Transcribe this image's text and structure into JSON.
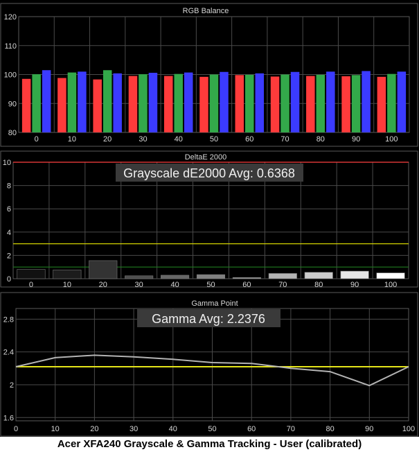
{
  "caption": "Acer XFA240 Grayscale & Gamma Tracking - User (calibrated)",
  "colors": {
    "panel_bg": "#000000",
    "frame": "#5a5a5a",
    "grid": "#4a4a4a",
    "text": "#d8d8d8",
    "red": "#ff3b3b",
    "green": "#33a94a",
    "blue": "#3b3bff",
    "gamma_line": "#b4b4b4",
    "target_line": "#e6e619",
    "threshold_yellow": "#d4d400",
    "threshold_green": "#1f7a1f",
    "threshold_red": "#ff4040",
    "overlay_bg": "#3a3a3a"
  },
  "chart_data": [
    {
      "type": "bar",
      "title": "RGB Balance",
      "categories": [
        "0",
        "10",
        "20",
        "30",
        "40",
        "50",
        "60",
        "70",
        "80",
        "90",
        "100"
      ],
      "yticks": [
        "80",
        "90",
        "100",
        "110",
        "120"
      ],
      "ylim": [
        80,
        120
      ],
      "series": [
        {
          "color_key": "red",
          "values": [
            98.5,
            98.8,
            98.3,
            99.5,
            99.5,
            99.2,
            99.8,
            99.3,
            99.5,
            99.4,
            99.2
          ]
        },
        {
          "color_key": "green",
          "values": [
            100.1,
            100.7,
            101.5,
            100.1,
            100.2,
            100.0,
            99.9,
            100.0,
            99.9,
            99.8,
            100.2
          ]
        },
        {
          "color_key": "blue",
          "values": [
            101.5,
            101.0,
            100.4,
            100.6,
            100.7,
            100.9,
            100.4,
            100.9,
            101.0,
            101.2,
            101.0
          ]
        }
      ],
      "grid": true
    },
    {
      "type": "bar",
      "title": "DeltaE 2000",
      "overlay": "Grayscale dE2000 Avg: 0.6368",
      "categories": [
        "0",
        "10",
        "20",
        "30",
        "40",
        "50",
        "60",
        "70",
        "80",
        "90",
        "100"
      ],
      "yticks": [
        "0",
        "2",
        "4",
        "6",
        "8",
        "10"
      ],
      "ylim": [
        0,
        10
      ],
      "values": [
        0.8,
        0.75,
        1.55,
        0.25,
        0.3,
        0.35,
        0.1,
        0.45,
        0.55,
        0.65,
        0.5
      ],
      "bar_shades": [
        "#111111",
        "#1c1c1c",
        "#333333",
        "#4d4d4d",
        "#666666",
        "#808080",
        "#999999",
        "#b3b3b3",
        "#cccccc",
        "#e6e6e6",
        "#ffffff"
      ],
      "reference_lines": [
        {
          "value": 10,
          "color_key": "threshold_red"
        },
        {
          "value": 3,
          "color_key": "threshold_yellow"
        },
        {
          "value": 1,
          "color_key": "threshold_green"
        }
      ],
      "grid": true
    },
    {
      "type": "line",
      "title": "Gamma Point",
      "overlay": "Gamma Avg: 2.2376",
      "x": [
        0,
        10,
        20,
        30,
        40,
        50,
        60,
        70,
        80,
        90,
        100
      ],
      "xticks": [
        "0",
        "10",
        "20",
        "30",
        "40",
        "50",
        "60",
        "70",
        "80",
        "90",
        "100"
      ],
      "values": [
        2.22,
        2.33,
        2.36,
        2.34,
        2.31,
        2.27,
        2.26,
        2.2,
        2.16,
        1.99,
        2.22
      ],
      "yticks": [
        "1.6",
        "2",
        "2.4",
        "2.8"
      ],
      "ylim": [
        1.56,
        2.93
      ],
      "xlim": [
        0,
        100
      ],
      "target": 2.22,
      "grid": true
    }
  ]
}
